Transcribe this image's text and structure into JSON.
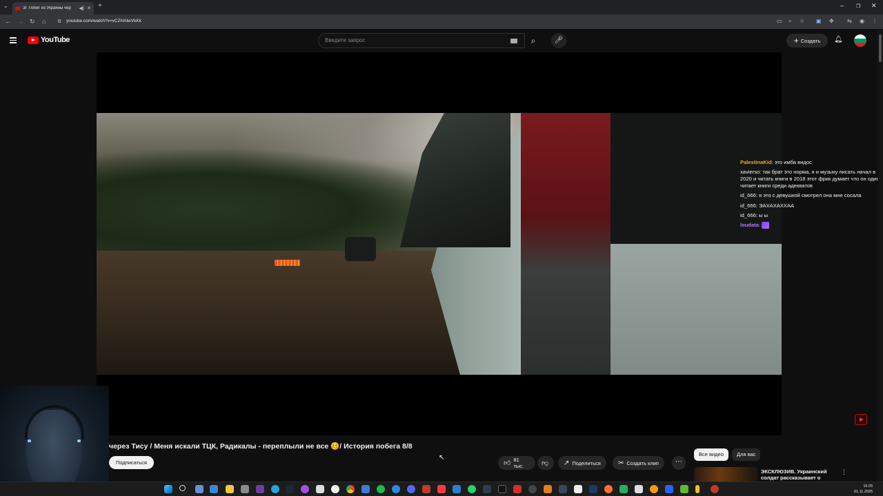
{
  "browser": {
    "tab_title": "ЗГ Побег из Украины чер",
    "url": "youtube.com/watch?v=vCZHAlwVkKk"
  },
  "youtube": {
    "logo_text": "YouTube",
    "search_placeholder": "Введите запрос",
    "create_label": "Создать"
  },
  "chat": [
    {
      "user": "PalestinaKid",
      "sep": ":",
      "text": " это имба видос",
      "color": "#f5a623"
    },
    {
      "user": "xavierso",
      "sep": ":",
      "text": " так брат это норма, я и музыку писать начал в 2020 и читать книги в 2018 этот фрик думает что он один читает книги среди адекватов",
      "color": "#f1f1f1"
    },
    {
      "user": "id_666",
      "sep": ":",
      "text": " я это с девушкой смотрел она мне сосала",
      "color": "#f1f1f1"
    },
    {
      "user": "id_666",
      "sep": ":",
      "text": " ЭАХАХАХХАА",
      "color": "#f1f1f1"
    },
    {
      "user": "id_666",
      "sep": ":",
      "text": " ы ы",
      "color": "#f1f1f1"
    },
    {
      "user": "loudata",
      "sep": ":",
      "text": "",
      "color": "#b17cff"
    }
  ],
  "video": {
    "title": "через Тису / Меня искали ТЦК, Радикалы - переплыли не все 🥴/ История побега 8/8",
    "subscribe_label": "Подписаться",
    "likes": "81 тыс.",
    "share_label": "Поделиться",
    "clip_label": "Создать клип"
  },
  "sidebar": {
    "chips": [
      "Все видео",
      "Для вас"
    ],
    "rec_title": "ЭКСКЛЮЗИВ. Украинский солдат рассказывает о"
  },
  "taskbar": {
    "time": "15:25",
    "date": "01.11.2025"
  },
  "colors": {
    "brand_red": "#ff0000",
    "chat_user_orange": "#f5a623",
    "chat_user_purple": "#b17cff"
  }
}
